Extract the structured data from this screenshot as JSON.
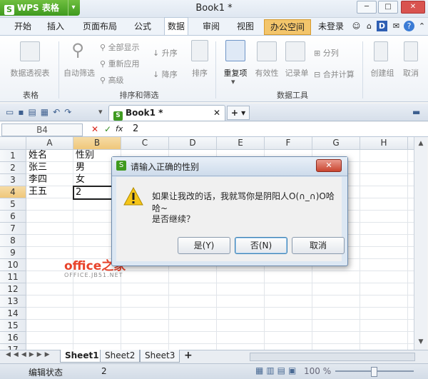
{
  "app": {
    "name": "WPS 表格",
    "doc_title": "Book1 *"
  },
  "menu": {
    "items": [
      "开始",
      "插入",
      "页面布局",
      "公式",
      "数据",
      "审阅",
      "视图",
      "办公空间"
    ],
    "login": "未登录"
  },
  "ribbon": {
    "pivot": "数据透视表",
    "autofilter": "自动筛选",
    "show_all": "全部显示",
    "reapply": "重新应用",
    "advanced": "高级",
    "asc": "升序",
    "desc": "降序",
    "sort": "排序",
    "dup": "重复项",
    "validity": "有效性",
    "record": "记录单",
    "split": "分列",
    "consolidate": "合并计算",
    "group": "创建组",
    "ungroup": "取消",
    "group_label_table": "表格",
    "group_label_sort": "排序和筛选",
    "group_label_tools": "数据工具"
  },
  "tab": {
    "name": "Book1 *"
  },
  "formula": {
    "cell_ref": "B4",
    "value": "2"
  },
  "grid": {
    "columns": [
      "A",
      "B",
      "C",
      "D",
      "E",
      "F",
      "G",
      "H"
    ],
    "rows": [
      "1",
      "2",
      "3",
      "4",
      "5",
      "6",
      "7",
      "8",
      "9",
      "10",
      "11",
      "12",
      "13",
      "14",
      "15",
      "16",
      "17"
    ],
    "cells": {
      "A1": "姓名",
      "B1": "性别",
      "A2": "张三",
      "B2": "男",
      "A3": "李四",
      "B3": "女",
      "A4": "王五",
      "B4": "2"
    }
  },
  "sheets": [
    "Sheet1",
    "Sheet2",
    "Sheet3"
  ],
  "status": {
    "mode": "编辑状态",
    "value": "2",
    "zoom": "100 %"
  },
  "dialog": {
    "title": "请输入正确的性别",
    "message": "如果让我改的话，我就骂你是阴阳人O(∩_∩)O哈哈~",
    "question": "是否继续？",
    "yes": "是(Y)",
    "no": "否(N)",
    "cancel": "取消"
  },
  "watermark": {
    "main": "office之家",
    "sub": "OFFICE.JB51.NET"
  },
  "colors": {
    "accent_green": "#3f9a1f",
    "office_tab": "#f3c56b",
    "select_blue": "#c9d8ec"
  }
}
